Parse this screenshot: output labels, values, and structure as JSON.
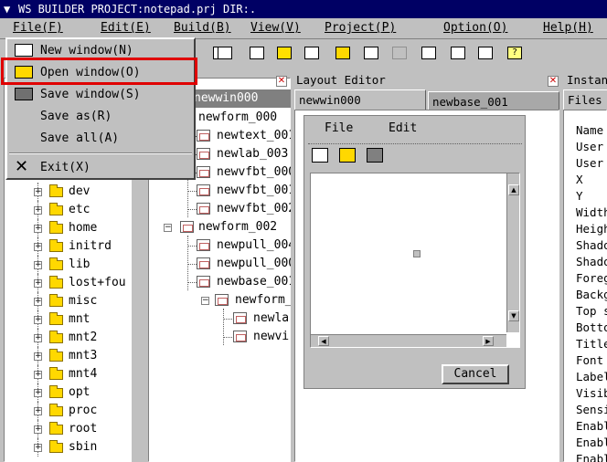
{
  "window": {
    "title": "WS BUILDER PROJECT:notepad.prj DIR:."
  },
  "menubar": [
    {
      "label": "File(F)"
    },
    {
      "label": "Edit(E)"
    },
    {
      "label": "Build(B)"
    },
    {
      "label": "View(V)"
    },
    {
      "label": "Project(P)"
    },
    {
      "label": "Option(O)"
    },
    {
      "label": "Help(H)"
    }
  ],
  "file_menu": {
    "items": [
      {
        "label": "New window(N)",
        "icon": "new-window-icon"
      },
      {
        "label": "Open window(O)",
        "icon": "open-folder-icon",
        "highlighted": true
      },
      {
        "label": "Save window(S)",
        "icon": "save-icon"
      },
      {
        "label": "Save as(R)"
      },
      {
        "label": "Save all(A)"
      },
      {
        "label": "Exit(X)",
        "icon": "exit-icon"
      }
    ]
  },
  "dir_tree": {
    "items": [
      "dev",
      "etc",
      "home",
      "initrd",
      "lib",
      "lost+fou",
      "misc",
      "mnt",
      "mnt2",
      "mnt3",
      "mnt4",
      "opt",
      "proc",
      "root",
      "sbin"
    ]
  },
  "widget_tree": {
    "header": "newwin000",
    "items": [
      {
        "label": "newform_000",
        "level": 1
      },
      {
        "label": "newtext_001",
        "level": 2
      },
      {
        "label": "newlab_003",
        "level": 2
      },
      {
        "label": "newvfbt_000",
        "level": 2
      },
      {
        "label": "newvfbt_001",
        "level": 2
      },
      {
        "label": "newvfbt_002",
        "level": 2
      },
      {
        "label": "newform_002",
        "level": 1
      },
      {
        "label": "newpull_004",
        "level": 2
      },
      {
        "label": "newpull_000",
        "level": 2
      },
      {
        "label": "newbase_001",
        "level": 2
      },
      {
        "label": "newform_0",
        "level": 3
      },
      {
        "label": "newla",
        "level": 4
      },
      {
        "label": "newvi",
        "level": 4
      }
    ]
  },
  "layout_editor": {
    "title": "Layout Editor",
    "tabs": [
      {
        "label": "newwin000",
        "active": true
      },
      {
        "label": "newbase_001",
        "active": false
      }
    ],
    "preview": {
      "menu": [
        "File",
        "Edit"
      ],
      "cancel_label": "Cancel"
    }
  },
  "instance_panel": {
    "title": "Instanc",
    "tab": "Files",
    "props": [
      "Name",
      "User",
      "User",
      "X",
      "Y",
      "Width",
      "Heigh",
      "Shado",
      "Shado",
      "Foreg",
      "Backg",
      "Top s",
      "Botto",
      "Title",
      "Font",
      "Label",
      "Visib",
      "Sensi",
      "Enabl",
      "Enabl",
      "Enabl"
    ]
  },
  "colors": {
    "titlebar": "#000064",
    "highlight": "#e00000",
    "face": "#c0c0c0"
  }
}
